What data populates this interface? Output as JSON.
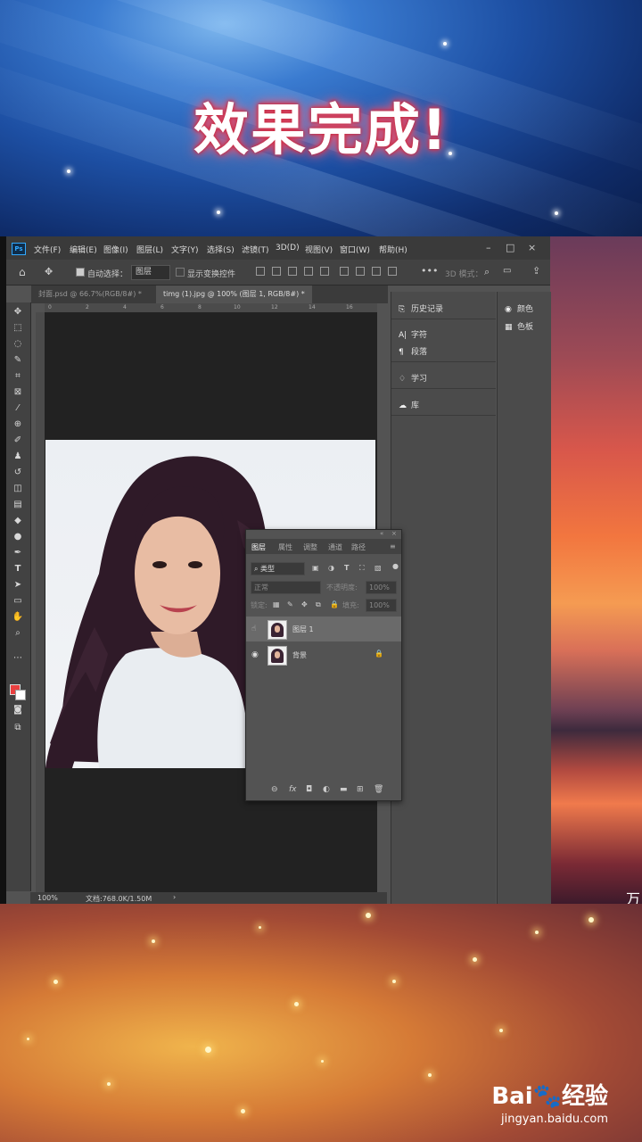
{
  "banner": {
    "headline": "效果完成!"
  },
  "photoshop": {
    "app_icon": "Ps",
    "menu": [
      "文件(F)",
      "编辑(E)",
      "图像(I)",
      "图层(L)",
      "文字(Y)",
      "选择(S)",
      "滤镜(T)",
      "3D(D)",
      "视图(V)",
      "窗口(W)",
      "帮助(H)"
    ],
    "window_controls": [
      "–",
      "□",
      "×"
    ],
    "options": {
      "auto_select_label": "自动选择：",
      "auto_select_value": "图层",
      "show_transform_label": "显示变换控件",
      "mode_3d_label": "3D 模式："
    },
    "tabs": [
      "封面.psd @ 66.7%(RGB/8#) *",
      "timg (1).jpg @ 100% (图层 1, RGB/8#) *"
    ],
    "ruler_ticks": [
      "0",
      "2",
      "4",
      "6",
      "8",
      "10",
      "12",
      "14",
      "16"
    ],
    "status": {
      "zoom": "100%",
      "doc": "文档:768.0K/1.50M"
    },
    "side_panels": {
      "history": "历史记录",
      "character": "字符",
      "paragraph": "段落",
      "learn": "学习",
      "libraries": "库",
      "color": "颜色",
      "swatches": "色板"
    },
    "layers_panel": {
      "tabs": [
        "图层",
        "属性",
        "调整",
        "通道",
        "路径"
      ],
      "filter_kind": "类型",
      "blend_mode": "正常",
      "opacity_label": "不透明度:",
      "opacity_value": "100%",
      "lock_label": "锁定:",
      "fill_label": "填充:",
      "fill_value": "100%",
      "layers": [
        {
          "name": "图层 1",
          "visible": false,
          "selected": true
        },
        {
          "name": "背景",
          "visible": true,
          "locked": true
        }
      ]
    }
  },
  "watermark": {
    "logo": "Bai🐾经验",
    "url": "jingyan.baidu.com"
  },
  "sunset_char": "万"
}
